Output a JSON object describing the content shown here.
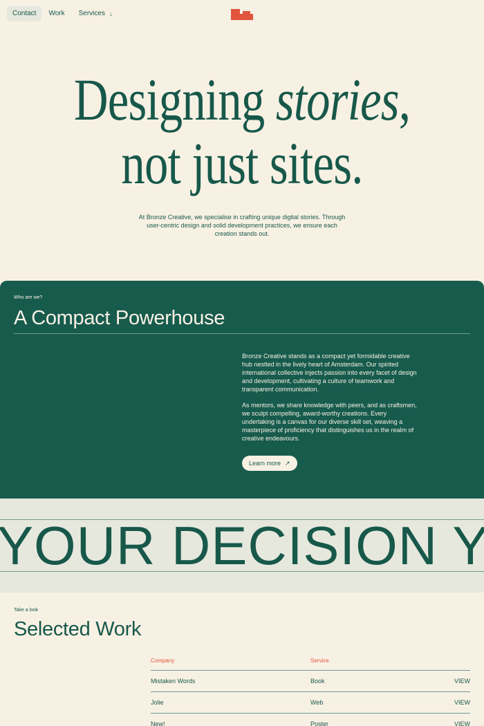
{
  "nav": {
    "items": [
      {
        "label": "Contact"
      },
      {
        "label": "Work"
      },
      {
        "label": "Services"
      }
    ],
    "services_arrow": "↓"
  },
  "brand": {
    "accent": "#e1553d",
    "primary": "#17584a",
    "background": "#f7f1e4"
  },
  "hero": {
    "line1_a": "Designing ",
    "line1_b": "stories",
    "line1_c": ",",
    "line2": "not just sites.",
    "subtitle": "At Bronze Creative, we specialise in crafting unique digital stories. Through user-centric design and solid development practices, we ensure each creation stands out."
  },
  "about": {
    "eyebrow": "Who are we?",
    "heading": "A Compact Powerhouse",
    "paragraph1": "Bronze Creative stands as a compact yet formidable creative hub nestled in the lively heart of Amsterdam. Our spirited international collective injects passion into every facet of design and development, cultivating a culture of teamwork and transparent communication.",
    "paragraph2": "As mentors, we share knowledge with peers, and as craftsmen, we sculpt compelling, award-worthy creations. Every undertaking is a canvas for our diverse skill set, weaving a masterpiece of proficiency that distinguishes us in the realm of creative endeavours.",
    "button_label": "Learn more",
    "button_icon": "↗"
  },
  "marquee": {
    "text": "YOUR DECISION YOUR DECISION"
  },
  "work": {
    "eyebrow": "Take a look",
    "title": "Selected Work",
    "headers": {
      "company": "Company",
      "service": "Service"
    },
    "rows": [
      {
        "company": "Mistaken Words",
        "service": "Book",
        "action": "VIEW"
      },
      {
        "company": "Jolie",
        "service": "Web",
        "action": "VIEW"
      },
      {
        "company": "New!",
        "service": "Poster",
        "action": "VIEW"
      }
    ]
  }
}
